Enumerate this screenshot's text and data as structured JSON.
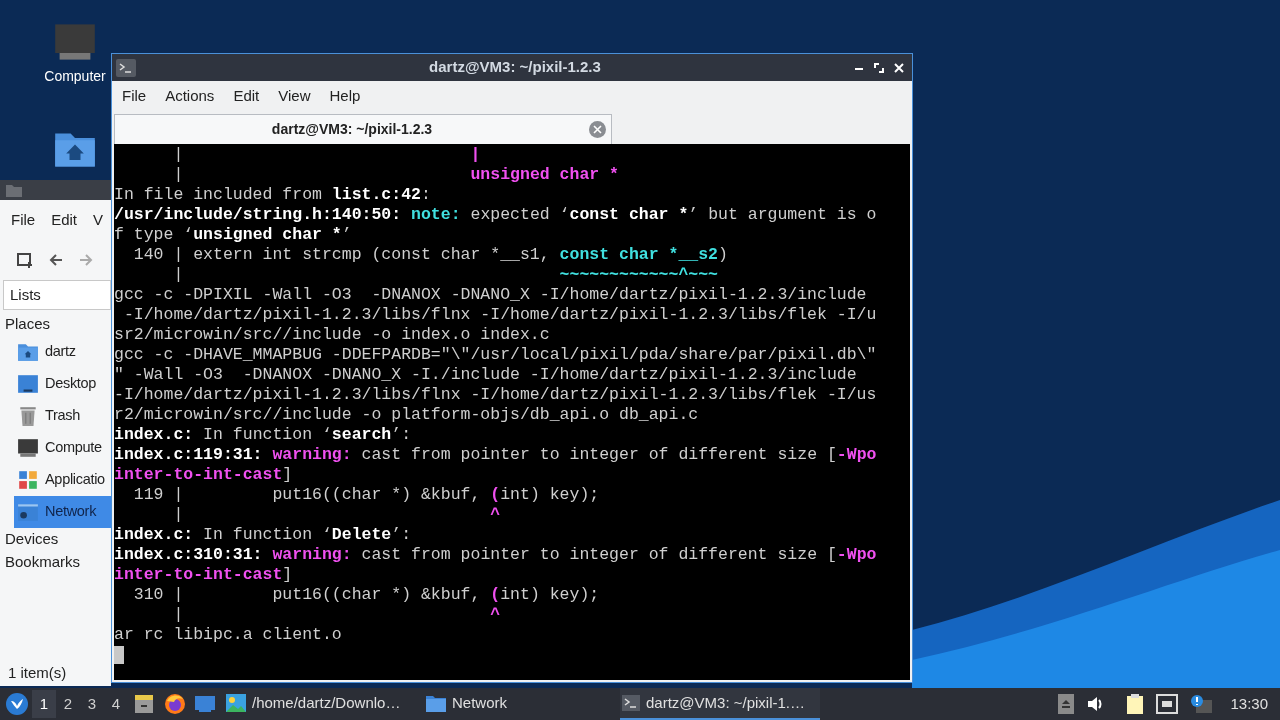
{
  "desktop_icons": [
    {
      "kind": "computer",
      "label": "Computer"
    },
    {
      "kind": "home-folder"
    }
  ],
  "file_manager": {
    "menu": [
      "File",
      "Edit",
      "V"
    ],
    "view": "Lists",
    "sidebar": [
      {
        "label": "Places",
        "items": [
          {
            "kind": "home",
            "label": "dartz",
            "selected": false
          },
          {
            "kind": "desktop",
            "label": "Desktop",
            "selected": false
          },
          {
            "kind": "trash",
            "label": "Trash",
            "selected": false
          },
          {
            "kind": "computer",
            "label": "Compute",
            "selected": false
          },
          {
            "kind": "apps",
            "label": "Applicatio",
            "selected": false
          },
          {
            "kind": "network",
            "label": "Network",
            "selected": true
          }
        ]
      },
      {
        "label": "Devices"
      },
      {
        "label": "Bookmarks"
      }
    ],
    "status_bar": "1 item(s)"
  },
  "terminal": {
    "title": "dartz@VM3: ~/pixil-1.2.3",
    "menu": [
      "File",
      "Actions",
      "Edit",
      "View",
      "Help"
    ],
    "tabs": [
      {
        "label": "dartz@VM3: ~/pixil-1.2.3",
        "selected": true
      }
    ],
    "lines": [
      [
        {
          "kind": "plain",
          "text": "      |                             "
        },
        {
          "kind": "magenta",
          "text": "|"
        }
      ],
      [
        {
          "kind": "plain",
          "text": "      |                             "
        },
        {
          "kind": "magenta",
          "text": "unsigned char *"
        }
      ],
      [
        {
          "kind": "plain",
          "text": "In file included from "
        },
        {
          "kind": "bold",
          "text": "list.c:42"
        },
        {
          "kind": "plain",
          "text": ":"
        }
      ],
      [
        {
          "kind": "bold",
          "text": "/usr/include/string.h:140:50: "
        },
        {
          "kind": "cyan",
          "text": "note:"
        },
        {
          "kind": "plain",
          "text": " expected ‘"
        },
        {
          "kind": "bold",
          "text": "const char *"
        },
        {
          "kind": "plain",
          "text": "’ but argument is o"
        }
      ],
      [
        {
          "kind": "plain",
          "text": "f type ‘"
        },
        {
          "kind": "bold",
          "text": "unsigned char *"
        },
        {
          "kind": "plain",
          "text": "’"
        }
      ],
      [
        {
          "kind": "plain",
          "text": "  140 | extern int strcmp (const char *__s1, "
        },
        {
          "kind": "cyan",
          "text": "const char *__s2"
        },
        {
          "kind": "plain",
          "text": ")"
        }
      ],
      [
        {
          "kind": "plain",
          "text": "      |                                      "
        },
        {
          "kind": "cyan",
          "text": "~~~~~~~~~~~~^~~~"
        }
      ],
      [
        {
          "kind": "plain",
          "text": "gcc -c -DPIXIL -Wall -O3  -DNANOX -DNANO_X -I/home/dartz/pixil-1.2.3/include"
        }
      ],
      [
        {
          "kind": "plain",
          "text": " -I/home/dartz/pixil-1.2.3/libs/flnx -I/home/dartz/pixil-1.2.3/libs/flek -I/u"
        }
      ],
      [
        {
          "kind": "plain",
          "text": "sr2/microwin/src//include -o index.o index.c"
        }
      ],
      [
        {
          "kind": "plain",
          "text": "gcc -c -DHAVE_MMAPBUG -DDEFPARDB=\"\\\"/usr/local/pixil/pda/share/par/pixil.db\\\""
        }
      ],
      [
        {
          "kind": "plain",
          "text": "\" -Wall -O3  -DNANOX -DNANO_X -I./include -I/home/dartz/pixil-1.2.3/include"
        }
      ],
      [
        {
          "kind": "plain",
          "text": "-I/home/dartz/pixil-1.2.3/libs/flnx -I/home/dartz/pixil-1.2.3/libs/flek -I/us"
        }
      ],
      [
        {
          "kind": "plain",
          "text": "r2/microwin/src//include -o platform-objs/db_api.o db_api.c"
        }
      ],
      [
        {
          "kind": "bold",
          "text": "index.c:"
        },
        {
          "kind": "plain",
          "text": " In function ‘"
        },
        {
          "kind": "bold",
          "text": "search"
        },
        {
          "kind": "plain",
          "text": "’:"
        }
      ],
      [
        {
          "kind": "bold",
          "text": "index.c:119:31: "
        },
        {
          "kind": "magenta",
          "text": "warning:"
        },
        {
          "kind": "plain",
          "text": " cast from pointer to integer of different size ["
        },
        {
          "kind": "magenta",
          "text": "-Wpo"
        }
      ],
      [
        {
          "kind": "magenta",
          "text": "inter-to-int-cast"
        },
        {
          "kind": "plain",
          "text": "]"
        }
      ],
      [
        {
          "kind": "plain",
          "text": "  119 |         put16((char *) &kbuf, "
        },
        {
          "kind": "magenta",
          "text": "("
        },
        {
          "kind": "plain",
          "text": "int) key);"
        }
      ],
      [
        {
          "kind": "plain",
          "text": "      |                               "
        },
        {
          "kind": "magenta",
          "text": "^"
        }
      ],
      [
        {
          "kind": "bold",
          "text": "index.c:"
        },
        {
          "kind": "plain",
          "text": " In function ‘"
        },
        {
          "kind": "bold",
          "text": "Delete"
        },
        {
          "kind": "plain",
          "text": "’:"
        }
      ],
      [
        {
          "kind": "bold",
          "text": "index.c:310:31: "
        },
        {
          "kind": "magenta",
          "text": "warning:"
        },
        {
          "kind": "plain",
          "text": " cast from pointer to integer of different size ["
        },
        {
          "kind": "magenta",
          "text": "-Wpo"
        }
      ],
      [
        {
          "kind": "magenta",
          "text": "inter-to-int-cast"
        },
        {
          "kind": "plain",
          "text": "]"
        }
      ],
      [
        {
          "kind": "plain",
          "text": "  310 |         put16((char *) &kbuf, "
        },
        {
          "kind": "magenta",
          "text": "("
        },
        {
          "kind": "plain",
          "text": "int) key);"
        }
      ],
      [
        {
          "kind": "plain",
          "text": "      |                               "
        },
        {
          "kind": "magenta",
          "text": "^"
        }
      ],
      [
        {
          "kind": "plain",
          "text": "ar rc libipc.a client.o"
        }
      ]
    ]
  },
  "taskbar": {
    "workspaces": [
      {
        "label": "1",
        "selected": true
      },
      {
        "label": "2",
        "selected": false
      },
      {
        "label": "3",
        "selected": false
      },
      {
        "label": "4",
        "selected": false
      }
    ],
    "tasks": [
      {
        "kind": "image",
        "label": "/home/dartz/Downlo…",
        "selected": false
      },
      {
        "kind": "folder",
        "label": "Network",
        "selected": false
      },
      {
        "kind": "terminal",
        "label": "dartz@VM3: ~/pixil-1.…",
        "selected": true
      }
    ],
    "clock": "13:30"
  }
}
